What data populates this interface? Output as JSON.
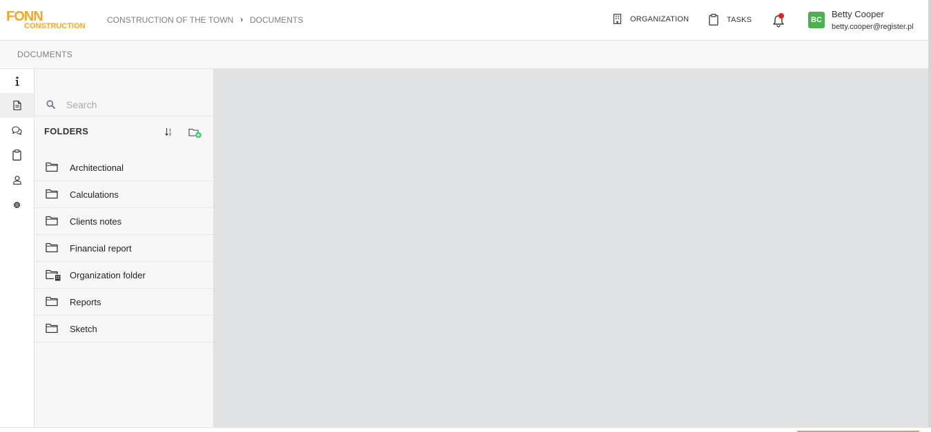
{
  "brand": {
    "logo_top": "FONN",
    "logo_bottom": "CONSTRUCTION",
    "color": "#f5a623"
  },
  "breadcrumb": {
    "project": "CONSTRUCTION OF THE TOWN",
    "separator": "›",
    "current": "DOCUMENTS"
  },
  "top_nav": {
    "organization_label": "ORGANIZATION",
    "tasks_label": "TASKS",
    "notification_icon": "bell-icon",
    "notification_dot_color": "#e02020"
  },
  "user": {
    "initials": "BC",
    "name": "Betty Cooper",
    "email": "betty.cooper@register.pl",
    "avatar_color": "#4caf50"
  },
  "subheader": {
    "title": "DOCUMENTS"
  },
  "rail": {
    "items": [
      {
        "icon": "info-icon",
        "active": false
      },
      {
        "icon": "document-icon",
        "active": true
      },
      {
        "icon": "chat-icon",
        "active": false
      },
      {
        "icon": "clipboard-icon",
        "active": false
      },
      {
        "icon": "user-icon",
        "active": false
      },
      {
        "icon": "gear-icon",
        "active": false
      }
    ]
  },
  "folder_panel": {
    "search_placeholder": "Search",
    "title": "FOLDERS",
    "folders": [
      {
        "label": "Architectional",
        "icon": "folder-icon"
      },
      {
        "label": "Calculations",
        "icon": "folder-icon"
      },
      {
        "label": "Clients notes",
        "icon": "folder-icon"
      },
      {
        "label": "Financial report",
        "icon": "folder-icon"
      },
      {
        "label": "Organization folder",
        "icon": "organization-folder-icon"
      },
      {
        "label": "Reports",
        "icon": "folder-icon"
      },
      {
        "label": "Sketch",
        "icon": "folder-icon"
      }
    ]
  },
  "colors": {
    "content_bg": "#e1e2e4",
    "add_accent": "#2ecc71"
  }
}
